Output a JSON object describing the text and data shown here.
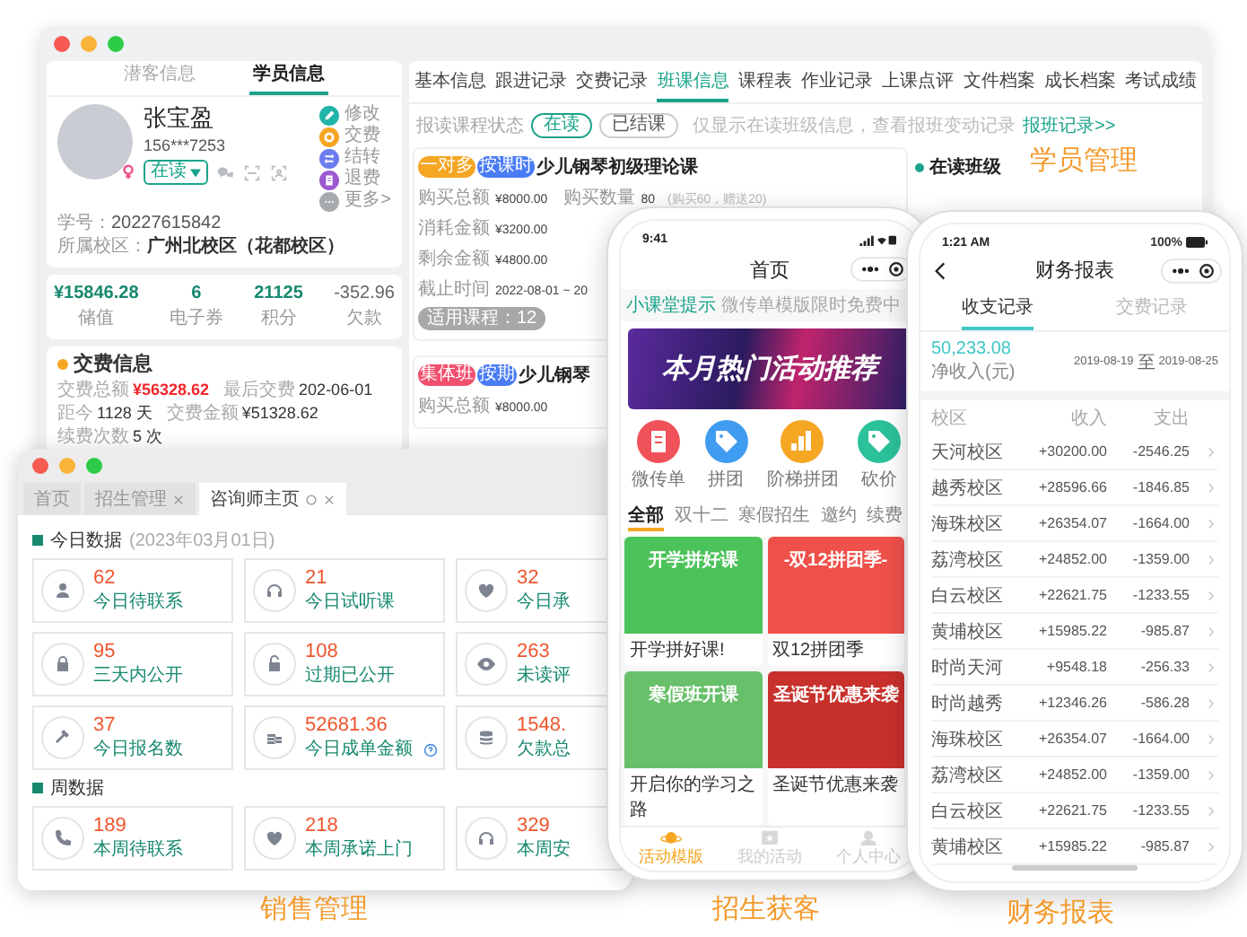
{
  "student_window": {
    "left_tabs": [
      {
        "label": "潜客信息",
        "selected": false
      },
      {
        "label": "学员信息",
        "selected": true
      }
    ],
    "profile": {
      "name": "张宝盈",
      "phone": "156***7253",
      "status": "在读",
      "id_label": "学号：",
      "id": "20227615842",
      "campus_label": "所属校区：",
      "campus": "广州北校区（花都校区）"
    },
    "actions": [
      {
        "label": "修改",
        "kind": "edit",
        "color": "#1fb5a8"
      },
      {
        "label": "交费",
        "kind": "coin",
        "color": "#f5a623"
      },
      {
        "label": "结转",
        "kind": "transfer",
        "color": "#6c7cf0"
      },
      {
        "label": "退费",
        "kind": "refund",
        "color": "#9b59d0"
      },
      {
        "label": "更多>",
        "kind": "more",
        "color": "#a7abb0"
      }
    ],
    "stats": [
      {
        "value": "¥15846.28",
        "label": "储值",
        "kind": "asset"
      },
      {
        "value": "6",
        "label": "电子券",
        "kind": "asset"
      },
      {
        "value": "21125",
        "label": "积分",
        "kind": "asset"
      },
      {
        "value": "-352.96",
        "label": "欠款",
        "kind": "debt"
      }
    ],
    "payment": {
      "title": "交费信息",
      "items": [
        {
          "label": "交费总额",
          "value": "¥56328.62",
          "kind": "highlight"
        },
        {
          "label": "最后交费",
          "value": "202-06-01",
          "kind": "plain"
        },
        {
          "label": "距今",
          "value": "1128 天",
          "kind": "plain"
        },
        {
          "label": "交费金额",
          "value": "¥51328.62",
          "kind": "plain"
        },
        {
          "label": "续费次数",
          "value": "5 次",
          "kind": "plain"
        }
      ]
    },
    "tabs": [
      {
        "label": "基本信息",
        "selected": false
      },
      {
        "label": "跟进记录",
        "selected": false
      },
      {
        "label": "交费记录",
        "selected": false
      },
      {
        "label": "班课信息",
        "selected": true
      },
      {
        "label": "课程表",
        "selected": false
      },
      {
        "label": "作业记录",
        "selected": false
      },
      {
        "label": "上课点评",
        "selected": false
      },
      {
        "label": "文件档案",
        "selected": false
      },
      {
        "label": "成长档案",
        "selected": false
      },
      {
        "label": "考试成绩",
        "selected": false
      }
    ],
    "filter": {
      "label": "报读课程状态",
      "options": [
        {
          "label": "在读",
          "selected": true
        },
        {
          "label": "已结课",
          "selected": false
        }
      ],
      "hint": "仅显示在读班级信息，查看报班变动记录",
      "link": "报班记录>>"
    },
    "courses": [
      {
        "tags": [
          {
            "label": "一对多",
            "color": "#f5a623"
          },
          {
            "label": "按课时",
            "color": "#4a7cf5"
          }
        ],
        "title": "少儿钢琴初级理论课",
        "rows": [
          {
            "label": "购买总额",
            "value": "¥8000.00",
            "extra_label": "购买数量",
            "extra_value": "80",
            "note": "(购买60，赠送20)"
          },
          {
            "label": "消耗金额",
            "value": "¥3200.00"
          },
          {
            "label": "剩余金额",
            "value": "¥4800.00"
          },
          {
            "label": "截止时间",
            "value": "2022-08-01 ~ 20"
          }
        ],
        "footer": "适用课程：12"
      },
      {
        "tags": [
          {
            "label": "集体班",
            "color": "#f0506e"
          },
          {
            "label": "按期",
            "color": "#4a7cf5"
          }
        ],
        "title": "少儿钢琴",
        "rows": [
          {
            "label": "购买总额",
            "value": "¥8000.00"
          }
        ]
      }
    ],
    "current_class": {
      "title": "在读班级"
    },
    "caption": "学员管理"
  },
  "sales_window": {
    "tabs": [
      {
        "label": "首页",
        "selected": false,
        "closable": false
      },
      {
        "label": "招生管理",
        "selected": false,
        "closable": true
      },
      {
        "label": "咨询师主页",
        "selected": true,
        "closable": true
      }
    ],
    "today": {
      "title": "今日数据",
      "date": "(2023年03月01日)",
      "cards": [
        {
          "value": "62",
          "label": "今日待联系",
          "kind": "person",
          "help": false
        },
        {
          "value": "21",
          "label": "今日试听课",
          "kind": "headphones",
          "help": false
        },
        {
          "value": "32",
          "label": "今日承",
          "kind": "heart",
          "help": false
        },
        {
          "value": "95",
          "label": "三天内公开",
          "kind": "lock",
          "help": false
        },
        {
          "value": "108",
          "label": "过期已公开",
          "kind": "unlock",
          "help": false
        },
        {
          "value": "263",
          "label": "未读评",
          "kind": "eye",
          "help": false
        },
        {
          "value": "37",
          "label": "今日报名数",
          "kind": "hammer",
          "help": false
        },
        {
          "value": "52681.36",
          "label": "今日成单金额",
          "kind": "coins",
          "help": true
        },
        {
          "value": "1548.",
          "label": "欠款总",
          "kind": "stack",
          "help": false
        }
      ]
    },
    "week": {
      "title": "周数据",
      "cards": [
        {
          "value": "189",
          "label": "本周待联系",
          "kind": "phone",
          "help": false
        },
        {
          "value": "218",
          "label": "本周承诺上门",
          "kind": "heart",
          "help": false
        },
        {
          "value": "329",
          "label": "本周安",
          "kind": "headphones",
          "help": false
        }
      ]
    },
    "caption": "销售管理"
  },
  "promo_phone": {
    "time": "9:41",
    "title": "首页",
    "notice_tag": "小课堂提示",
    "notice": "微传单模版限时免费中",
    "banner": "本月热门活动推荐",
    "shortcuts": [
      {
        "label": "微传单",
        "kind": "doc",
        "color": "#f0525a"
      },
      {
        "label": "拼团",
        "kind": "tag",
        "color": "#3f9cf0"
      },
      {
        "label": "阶梯拼团",
        "kind": "chart",
        "color": "#f5a623"
      },
      {
        "label": "砍价",
        "kind": "tag",
        "color": "#2bc19a"
      }
    ],
    "tabs": [
      {
        "label": "全部",
        "selected": true
      },
      {
        "label": "双十二",
        "selected": false
      },
      {
        "label": "寒假招生",
        "selected": false
      },
      {
        "label": "邀约",
        "selected": false
      },
      {
        "label": "续费",
        "selected": false
      }
    ],
    "posters": [
      {
        "title": "开学拼好课!",
        "art": "开学拼好课",
        "color": "#4cc35a"
      },
      {
        "title": "双12拼团季",
        "art": "-双12拼团季-",
        "color": "#f0504a"
      },
      {
        "title": "开启你的学习之路",
        "art": "寒假班开课",
        "color": "#68c06a"
      },
      {
        "title": "圣诞节优惠来袭",
        "art": "圣诞节优惠来袭",
        "color": "#c8302c"
      }
    ],
    "nav": [
      {
        "label": "活动模版",
        "selected": true
      },
      {
        "label": "我的活动",
        "selected": false
      },
      {
        "label": "个人中心",
        "selected": false
      }
    ],
    "caption": "招生获客"
  },
  "finance_phone": {
    "time": "1:21 AM",
    "battery": "100%",
    "title": "财务报表",
    "tabs": [
      {
        "label": "收支记录",
        "selected": true
      },
      {
        "label": "交费记录",
        "selected": false
      }
    ],
    "net": "50,233.08",
    "net_label": "净收入(元)",
    "date_from": "2019-08-19",
    "date_sep": "至",
    "date_to": "2019-08-25",
    "columns": [
      "校区",
      "收入",
      "支出"
    ],
    "rows": [
      {
        "campus": "天河校区",
        "income": "+30200.00",
        "expense": "-2546.25"
      },
      {
        "campus": "越秀校区",
        "income": "+28596.66",
        "expense": "-1846.85"
      },
      {
        "campus": "海珠校区",
        "income": "+26354.07",
        "expense": "-1664.00"
      },
      {
        "campus": "荔湾校区",
        "income": "+24852.00",
        "expense": "-1359.00"
      },
      {
        "campus": "白云校区",
        "income": "+22621.75",
        "expense": "-1233.55"
      },
      {
        "campus": "黄埔校区",
        "income": "+15985.22",
        "expense": "-985.87"
      },
      {
        "campus": "时尚天河",
        "income": "+9548.18",
        "expense": "-256.33"
      },
      {
        "campus": "时尚越秀",
        "income": "+12346.26",
        "expense": "-586.28"
      },
      {
        "campus": "海珠校区",
        "income": "+26354.07",
        "expense": "-1664.00"
      },
      {
        "campus": "荔湾校区",
        "income": "+24852.00",
        "expense": "-1359.00"
      },
      {
        "campus": "白云校区",
        "income": "+22621.75",
        "expense": "-1233.55"
      },
      {
        "campus": "黄埔校区",
        "income": "+15985.22",
        "expense": "-985.87"
      }
    ],
    "caption": "财务报表"
  }
}
